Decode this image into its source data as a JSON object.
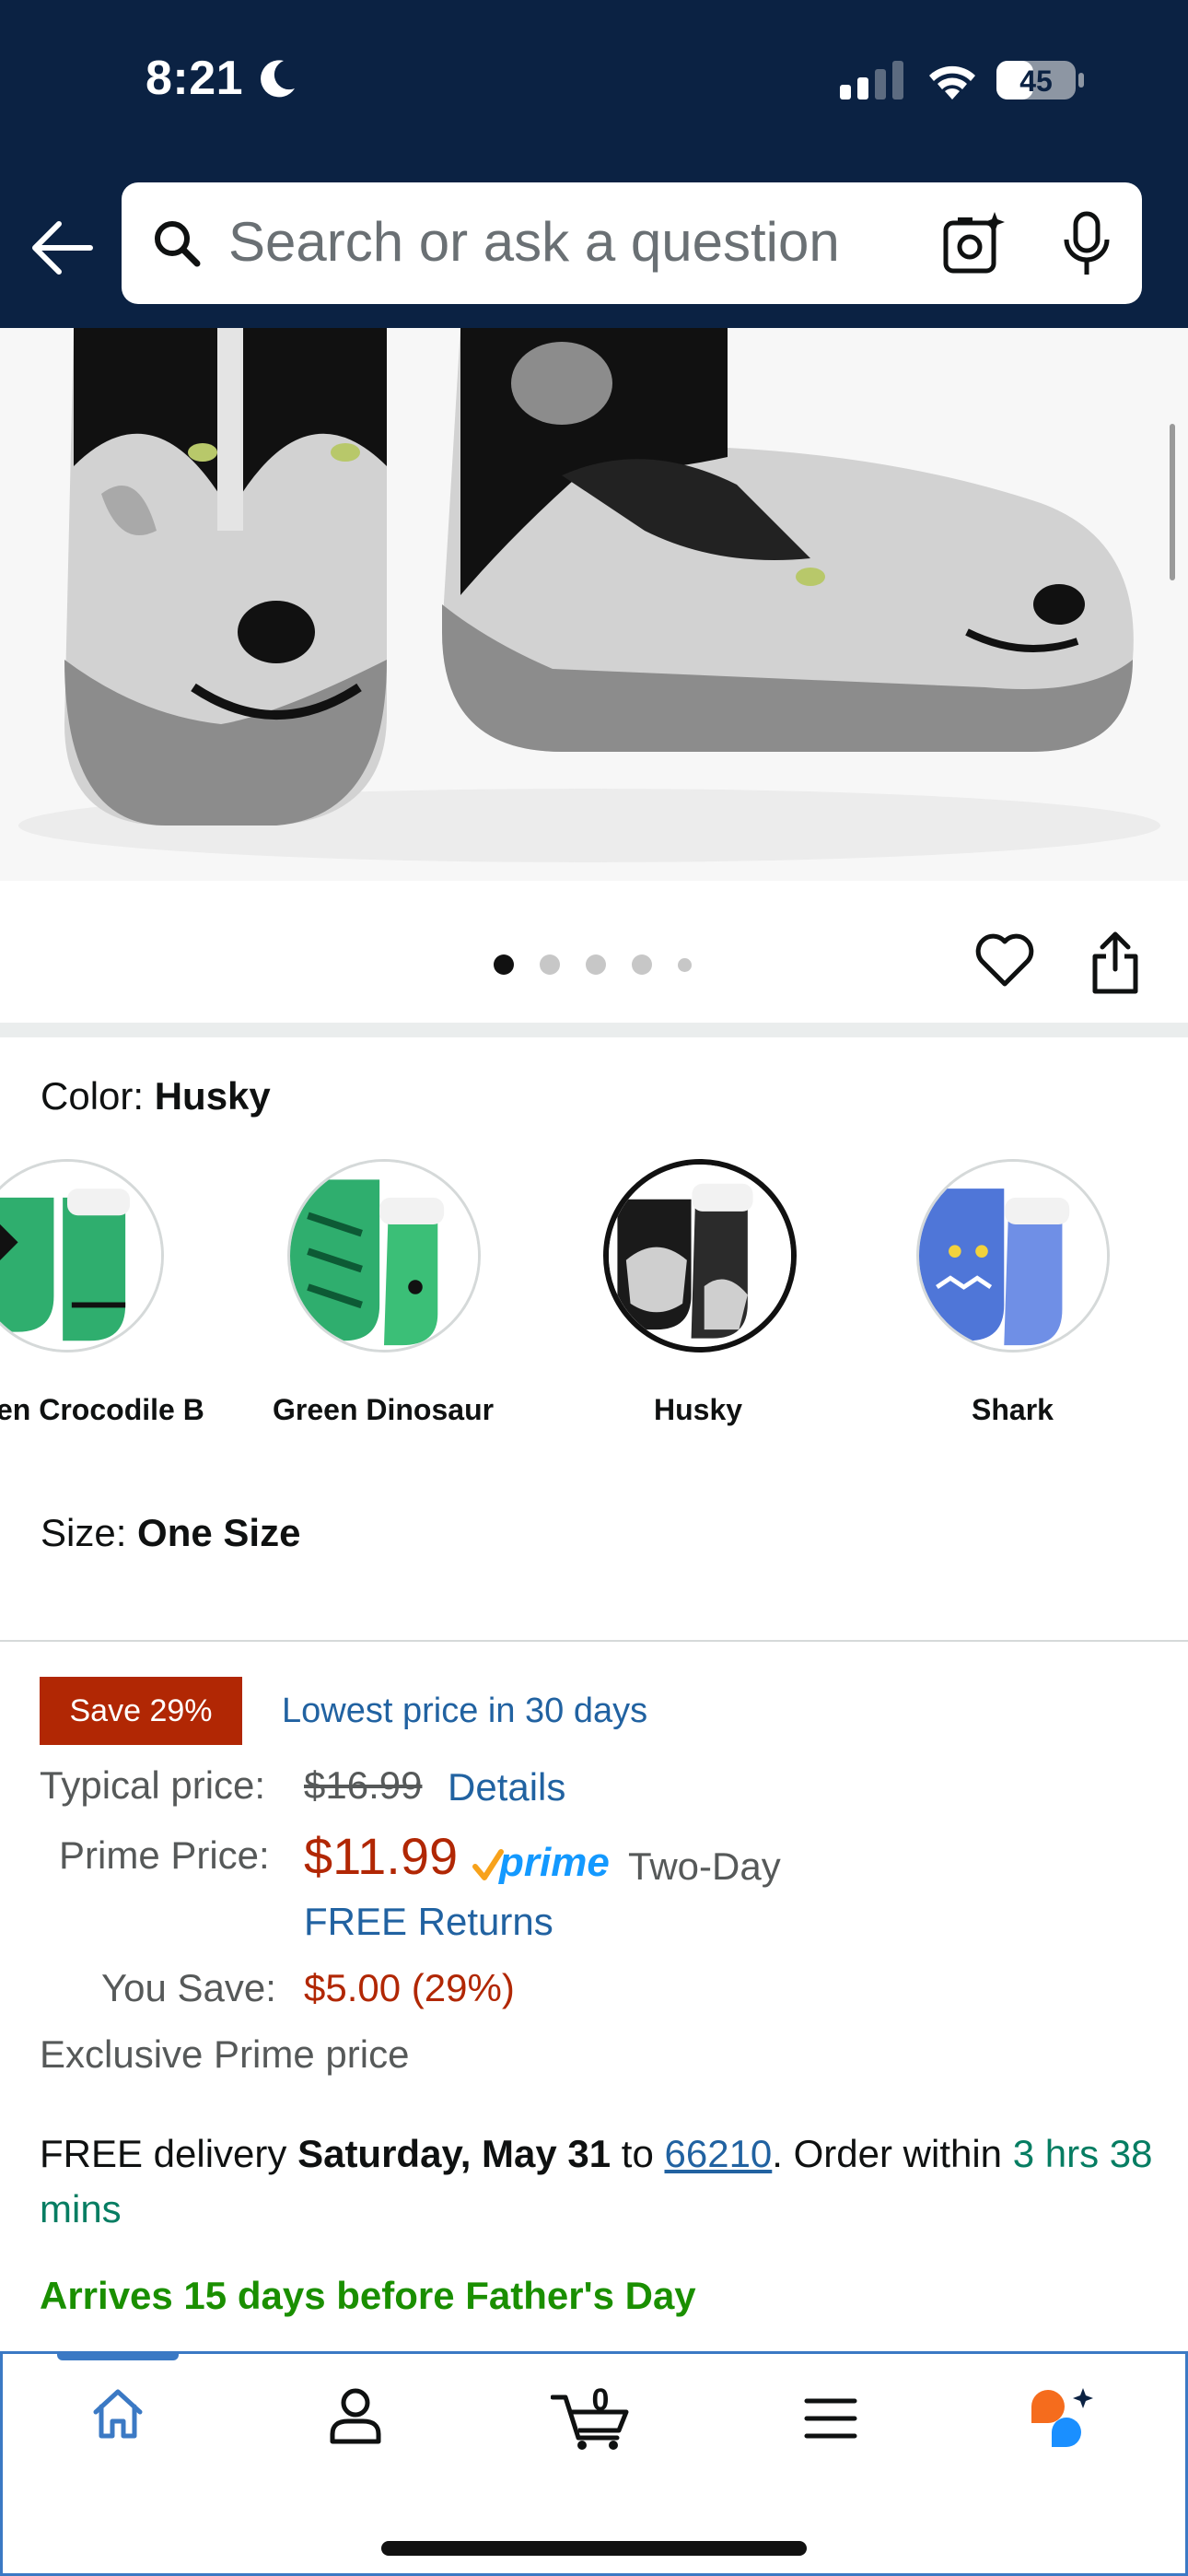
{
  "status_bar": {
    "time": "8:21",
    "battery": "45"
  },
  "search": {
    "placeholder": "Search or ask a question"
  },
  "product_image": {
    "pagination_pages": 5,
    "active_page": 1
  },
  "color": {
    "label": "Color: ",
    "selected": "Husky",
    "options": [
      {
        "label": "en Crocodile B"
      },
      {
        "label": "Green Dinosaur"
      },
      {
        "label": "Husky"
      },
      {
        "label": "Shark"
      }
    ]
  },
  "size": {
    "label": "Size: ",
    "value": "One Size"
  },
  "price": {
    "badge": "Save 29%",
    "lowest_note": "Lowest price in 30 days",
    "typical_label": "Typical price:",
    "typical_value": "$16.99",
    "details_link": "Details",
    "prime_label": "Prime Price:",
    "prime_value": "$11.99",
    "prime_brand": "prime",
    "two_day": "Two-Day",
    "free_returns": "FREE Returns",
    "save_label": "You Save:",
    "save_value": "$5.00 (29%)",
    "exclusive": "Exclusive Prime price"
  },
  "delivery": {
    "prefix": "FREE delivery ",
    "date": "Saturday, May 31",
    "to": " to ",
    "zip": "66210",
    "order_within": ". Order within ",
    "time_left": "3 hrs 38 mins"
  },
  "arrives": "Arrives 15 days before Father's Day",
  "bottom_nav": {
    "cart_count": "0"
  },
  "colors": {
    "header_bg": "#0b2243",
    "price_red": "#b12704",
    "link_blue": "#2162a1",
    "green": "#1a8f00",
    "prime_blue": "#1399ff"
  }
}
